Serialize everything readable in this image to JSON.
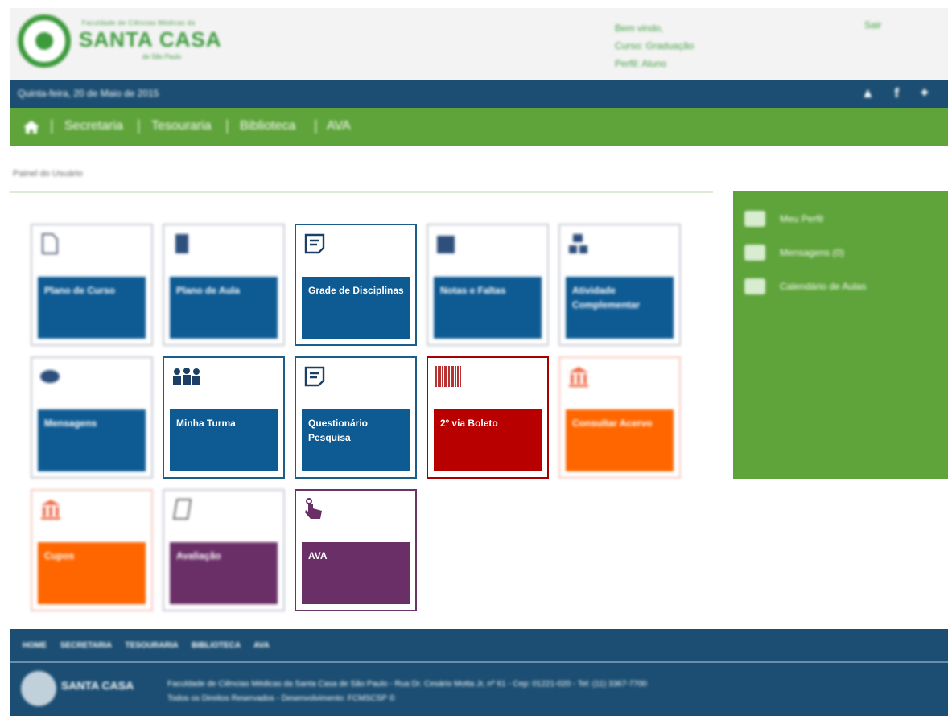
{
  "header": {
    "logo_top": "Faculdade de Ciências Médicas da",
    "logo_name": "SANTA CASA",
    "logo_sub": "de São Paulo",
    "welcome": "Bem vindo,",
    "course": "Curso: Graduação",
    "profile": "Perfil: Aluno",
    "exit": "Sair"
  },
  "datebar": {
    "date": "Quinta-feira, 20 de Maio de 2015",
    "social": "▲ f ✦"
  },
  "nav": {
    "items": [
      "Secretaria",
      "Tesouraria",
      "Biblioteca",
      "AVA"
    ],
    "separator": "|"
  },
  "breadcrumb": "Painel do Usuário",
  "side_panel": {
    "items": [
      {
        "label": "Meu Perfil",
        "icon": "profile-icon"
      },
      {
        "label": "Mensagens (0)",
        "icon": "megaphone-icon"
      },
      {
        "label": "Calendário de Aulas",
        "icon": "calendar-icon"
      }
    ]
  },
  "tiles": [
    {
      "label": "Plano de Curso",
      "color": "blue",
      "icon": "document-icon"
    },
    {
      "label": "Plano de Aula",
      "color": "blue",
      "icon": "book-icon"
    },
    {
      "label": "Grade de Disciplinas",
      "color": "blue",
      "icon": "note-icon"
    },
    {
      "label": "Notas e Faltas",
      "color": "blue",
      "icon": "calendar-icon"
    },
    {
      "label": "Atividade Complementar",
      "color": "blue",
      "icon": "network-icon"
    },
    {
      "label": "Mensagens",
      "color": "blue",
      "icon": "message-icon"
    },
    {
      "label": "Minha Turma",
      "color": "blue",
      "icon": "group-icon"
    },
    {
      "label": "Questionário Pesquisa",
      "color": "blue",
      "icon": "note-icon"
    },
    {
      "label": "2º via Boleto",
      "color": "red",
      "icon": "barcode-icon"
    },
    {
      "label": "Consultar Acervo",
      "color": "orange",
      "icon": "bank-icon"
    },
    {
      "label": "Cupos",
      "color": "orange",
      "icon": "bank-icon"
    },
    {
      "label": "Avaliação",
      "color": "purple",
      "icon": "checklist-icon"
    },
    {
      "label": "AVA",
      "color": "purple",
      "icon": "pointer-icon"
    }
  ],
  "footer": {
    "links": [
      "HOME",
      "SECRETARIA",
      "TESOURARIA",
      "BIBLIOTECA",
      "AVA"
    ],
    "logo_name": "SANTA CASA",
    "address": "Faculdade de Ciências Médicas da Santa Casa de São Paulo - Rua Dr. Cesário Motta Jr, nº 61 - Cep: 01221-020 - Tel: (11) 3367-7700",
    "rights": "Todos os Direitos Reservados - Desenvolvimento: FCMSCSP ©"
  },
  "colors": {
    "blue": "#0e5a93",
    "red": "#b80000",
    "orange": "#ff6600",
    "purple": "#6b2f68",
    "green": "#5ea43a",
    "navy": "#1b4e72"
  }
}
